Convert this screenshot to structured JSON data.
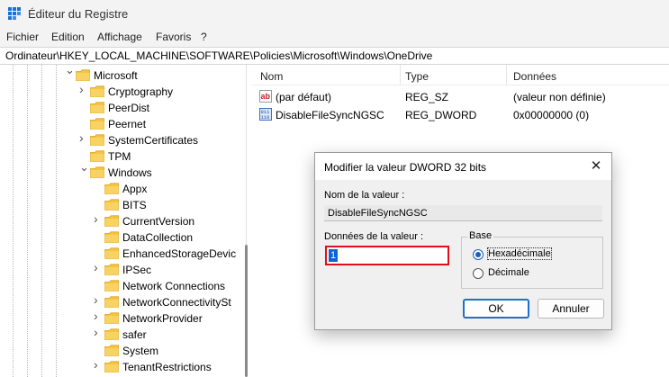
{
  "window": {
    "title": "Éditeur du Registre"
  },
  "menu": [
    "Fichier",
    "Edition",
    "Affichage",
    "Favoris",
    "?"
  ],
  "address": "Ordinateur\\HKEY_LOCAL_MACHINE\\SOFTWARE\\Policies\\Microsoft\\Windows\\OneDrive",
  "tree": {
    "items": [
      {
        "label": "Microsoft",
        "expanded": true
      },
      {
        "label": "Cryptography",
        "expanded": false
      },
      {
        "label": "PeerDist",
        "expanded": null
      },
      {
        "label": "Peernet",
        "expanded": null
      },
      {
        "label": "SystemCertificates",
        "expanded": false
      },
      {
        "label": "TPM",
        "expanded": null
      },
      {
        "label": "Windows",
        "expanded": true
      },
      {
        "label": "Appx",
        "expanded": null
      },
      {
        "label": "BITS",
        "expanded": null
      },
      {
        "label": "CurrentVersion",
        "expanded": false
      },
      {
        "label": "DataCollection",
        "expanded": null
      },
      {
        "label": "EnhancedStorageDevic",
        "expanded": null
      },
      {
        "label": "IPSec",
        "expanded": false
      },
      {
        "label": "Network Connections",
        "expanded": null
      },
      {
        "label": "NetworkConnectivitySt",
        "expanded": false
      },
      {
        "label": "NetworkProvider",
        "expanded": false
      },
      {
        "label": "safer",
        "expanded": false
      },
      {
        "label": "System",
        "expanded": null
      },
      {
        "label": "TenantRestrictions",
        "expanded": false
      }
    ]
  },
  "values_header": {
    "name": "Nom",
    "type": "Type",
    "data": "Données"
  },
  "values": [
    {
      "name": "(par défaut)",
      "type": "REG_SZ",
      "data": "(valeur non définie)",
      "icon": "string-value-icon"
    },
    {
      "name": "DisableFileSyncNGSC",
      "type": "REG_DWORD",
      "data": "0x00000000 (0)",
      "icon": "binary-value-icon"
    }
  ],
  "dialog": {
    "title": "Modifier la valeur DWORD 32 bits",
    "value_name_label": "Nom de la valeur :",
    "value_name": "DisableFileSyncNGSC",
    "value_data_label": "Données de la valeur :",
    "value_data": "1",
    "base_label": "Base",
    "base_options": [
      "Hexadécimale",
      "Décimale"
    ],
    "base_selected": "Hexadécimale",
    "ok_label": "OK",
    "cancel_label": "Annuler",
    "close_glyph": "✕"
  },
  "colors": {
    "folder": "#f5c542",
    "highlight": "#e0101a",
    "accent": "#1d6fd2"
  }
}
